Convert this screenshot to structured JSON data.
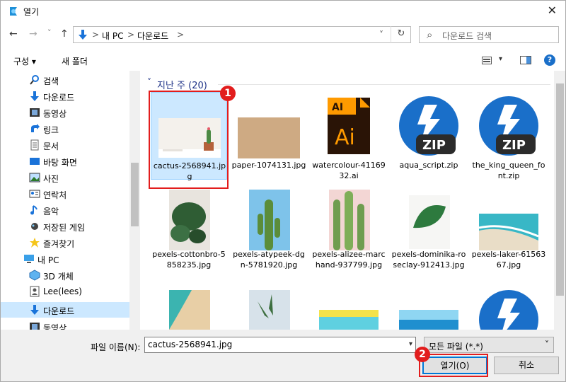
{
  "window": {
    "title": "열기",
    "close_glyph": "✕"
  },
  "nav": {
    "back": "←",
    "forward": "→",
    "dropdown": "˅",
    "up": "↑"
  },
  "address": {
    "crumbs": [
      "내 PC",
      "다운로드"
    ],
    "sep": ">",
    "chevron": "˅",
    "refresh": "↻"
  },
  "search": {
    "placeholder": "다운로드 검색",
    "icon": "⌕"
  },
  "toolbar": {
    "organize": "구성 ▾",
    "new_folder": "새 폴더",
    "help": "?"
  },
  "sidebar": {
    "items": [
      {
        "label": "검색",
        "icon": "search-icon"
      },
      {
        "label": "다운로드",
        "icon": "download-icon"
      },
      {
        "label": "동영상",
        "icon": "video-icon"
      },
      {
        "label": "링크",
        "icon": "link-icon"
      },
      {
        "label": "문서",
        "icon": "document-icon"
      },
      {
        "label": "바탕 화면",
        "icon": "desktop-icon"
      },
      {
        "label": "사진",
        "icon": "picture-icon"
      },
      {
        "label": "연락처",
        "icon": "contacts-icon"
      },
      {
        "label": "음악",
        "icon": "music-icon"
      },
      {
        "label": "저장된 게임",
        "icon": "games-icon"
      },
      {
        "label": "즐겨찾기",
        "icon": "favorites-icon"
      },
      {
        "label": "내 PC",
        "icon": "pc-icon"
      },
      {
        "label": "3D 개체",
        "icon": "3d-icon"
      },
      {
        "label": "Lee(lees)",
        "icon": "user-icon"
      },
      {
        "label": "다운로드",
        "icon": "download-icon"
      },
      {
        "label": "동영상",
        "icon": "video-icon"
      }
    ]
  },
  "group": {
    "header": "지난 주 (20)",
    "chevron": "˅"
  },
  "files": [
    {
      "name": "cactus-2568941.jpg",
      "type": "image"
    },
    {
      "name": "paper-1074131.jpg",
      "type": "image"
    },
    {
      "name": "watercolour-4116932.ai",
      "type": "ai"
    },
    {
      "name": "aqua_script.zip",
      "type": "zip"
    },
    {
      "name": "the_king_queen_font.zip",
      "type": "zip"
    },
    {
      "name": "pexels-cottonbro-5858235.jpg",
      "type": "image"
    },
    {
      "name": "pexels-atypeek-dgn-5781920.jpg",
      "type": "image"
    },
    {
      "name": "pexels-alizee-marchand-937799.jpg",
      "type": "image"
    },
    {
      "name": "pexels-dominika-roseclay-912413.jpg",
      "type": "image"
    },
    {
      "name": "pexels-laker-6156367.jpg",
      "type": "image"
    }
  ],
  "zip_label": "ZIP",
  "ai_label": "Ai",
  "bottom": {
    "filename_label": "파일 이름(N):",
    "filename_value": "cactus-2568941.jpg",
    "filter_value": "모든 파일 (*.*)",
    "open_button": "열기(O)",
    "cancel_button": "취소"
  },
  "annotations": {
    "badge1": "1",
    "badge2": "2"
  },
  "colors": {
    "accent": "#0078d7",
    "selection": "#cce8ff",
    "highlight": "#e21d1d"
  }
}
